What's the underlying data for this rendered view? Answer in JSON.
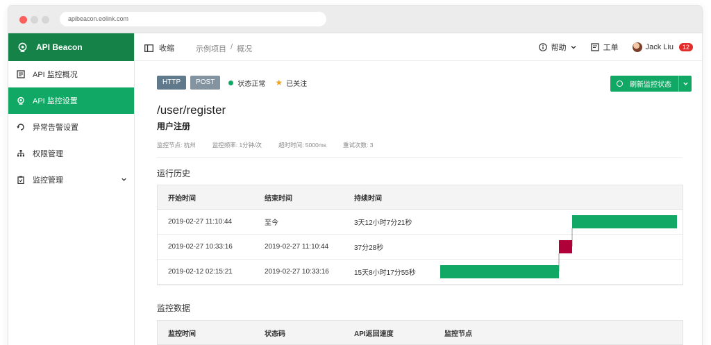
{
  "browser": {
    "url": "apibeacon.eolink.com"
  },
  "brand": {
    "name": "API Beacon"
  },
  "sidebar": {
    "items": [
      {
        "label": "API 监控概况",
        "icon": "overview-icon",
        "active": false
      },
      {
        "label": "API 监控设置",
        "icon": "monitor-settings-icon",
        "active": true
      },
      {
        "label": "异常告警设置",
        "icon": "alert-settings-icon",
        "active": false
      },
      {
        "label": "权限管理",
        "icon": "permission-icon",
        "active": false
      },
      {
        "label": "监控管理",
        "icon": "clipboard-icon",
        "active": false,
        "has_submenu": true
      }
    ]
  },
  "header": {
    "collapse_label": "收缩",
    "breadcrumb": [
      "示例项目",
      "/",
      "概况"
    ],
    "help_label": "帮助",
    "ticket_label": "工单",
    "user_name": "Jack Liu",
    "notification_count": "12"
  },
  "api": {
    "protocol": "HTTP",
    "method": "POST",
    "status_text": "状态正常",
    "follow_text": "已关注",
    "refresh_label": "刷新监控状态",
    "path": "/user/register",
    "name": "用户注册",
    "meta": {
      "node": "监控节点: 杭州",
      "frequency": "监控频率: 1分钟/次",
      "timeout": "超时时间: 5000ms",
      "retries": "重试次数: 3"
    }
  },
  "history": {
    "title": "运行历史",
    "columns": [
      "开始时间",
      "结束时间",
      "持续时间"
    ],
    "rows": [
      {
        "start": "2019-02-27 11:10:44",
        "end": "至今",
        "duration": "3天12小时7分21秒",
        "state": "normal"
      },
      {
        "start": "2019-02-27 10:33:16",
        "end": "2019-02-27 11:10:44",
        "duration": "37分28秒",
        "state": "error"
      },
      {
        "start": "2019-02-12 02:15:21",
        "end": "2019-02-27 10:33:16",
        "duration": "15天8小时17分55秒",
        "state": "normal"
      }
    ],
    "colors": {
      "normal": "#10a864",
      "error": "#b0003a"
    }
  },
  "monitor_data": {
    "title": "监控数据",
    "columns": [
      "监控时间",
      "状态码",
      "API返回速度",
      "监控节点"
    ]
  },
  "colors": {
    "brand_dark": "#158248",
    "accent": "#10a864",
    "badge": "#e22b2b"
  }
}
